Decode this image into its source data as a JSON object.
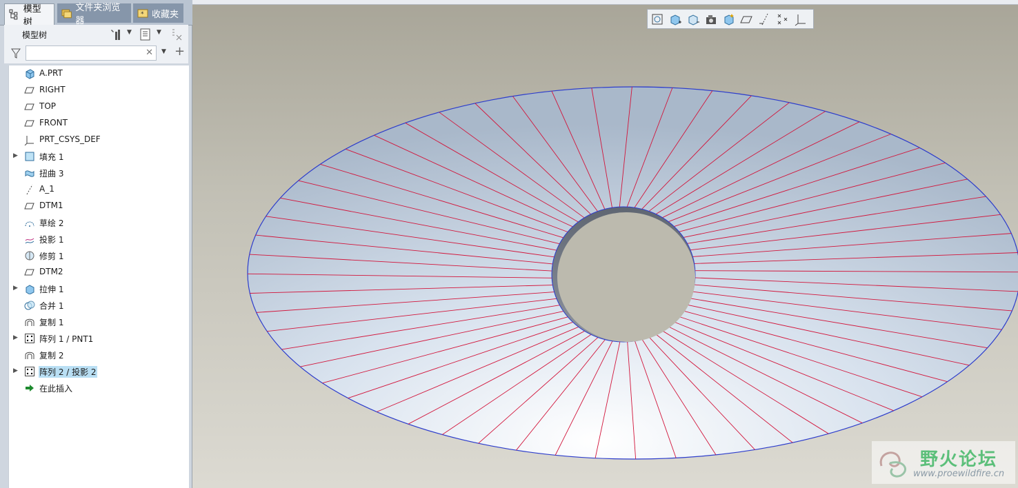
{
  "tabs": [
    {
      "label": "模型树",
      "icon": "model-tree-icon"
    },
    {
      "label": "文件夹浏览器",
      "icon": "folder-browser-icon"
    },
    {
      "label": "收藏夹",
      "icon": "favorites-icon"
    }
  ],
  "tree_header": {
    "title": "模型树"
  },
  "search": {
    "value": "",
    "placeholder": ""
  },
  "tree": [
    {
      "label": "A.PRT",
      "icon": "part-icon",
      "expandable": false
    },
    {
      "label": "RIGHT",
      "icon": "datum-plane-icon",
      "expandable": false
    },
    {
      "label": "TOP",
      "icon": "datum-plane-icon",
      "expandable": false
    },
    {
      "label": "FRONT",
      "icon": "datum-plane-icon",
      "expandable": false
    },
    {
      "label": "PRT_CSYS_DEF",
      "icon": "coordinate-system-icon",
      "expandable": false
    },
    {
      "label": "填充 1",
      "icon": "fill-icon",
      "expandable": true
    },
    {
      "label": "扭曲 3",
      "icon": "warp-icon",
      "expandable": false
    },
    {
      "label": "A_1",
      "icon": "datum-axis-icon",
      "expandable": false
    },
    {
      "label": "DTM1",
      "icon": "datum-plane-icon",
      "expandable": false
    },
    {
      "label": "草绘 2",
      "icon": "sketch-icon",
      "expandable": false
    },
    {
      "label": "投影 1",
      "icon": "projection-icon",
      "expandable": false
    },
    {
      "label": "修剪 1",
      "icon": "trim-icon",
      "expandable": false
    },
    {
      "label": "DTM2",
      "icon": "datum-plane-icon",
      "expandable": false
    },
    {
      "label": "拉伸 1",
      "icon": "extrude-icon",
      "expandable": true
    },
    {
      "label": "合并 1",
      "icon": "merge-icon",
      "expandable": false
    },
    {
      "label": "复制 1",
      "icon": "copy-icon",
      "expandable": false
    },
    {
      "label": "阵列 1 / PNT1",
      "icon": "pattern-icon",
      "expandable": true
    },
    {
      "label": "复制 2",
      "icon": "copy-icon",
      "expandable": false
    },
    {
      "label": "阵列 2 / 投影 2",
      "icon": "pattern-icon",
      "expandable": true,
      "selected": true
    },
    {
      "label": "在此插入",
      "icon": "insert-here-arrow-icon",
      "expandable": false
    }
  ],
  "view_toolbar": [
    "refit-icon",
    "zoom-in-icon",
    "zoom-out-icon",
    "repaint-icon",
    "saved-views-icon",
    "datum-plane-display-icon",
    "datum-axis-display-icon",
    "datum-point-display-icon",
    "csys-display-icon"
  ],
  "watermark": {
    "text": "野火论坛",
    "url": "www.proewildfire.cn"
  },
  "colors": {
    "surface": "#b8c7d8",
    "edge": "#2c3ccc",
    "isolines": "#d2143a",
    "selection": "#b9dff4"
  }
}
